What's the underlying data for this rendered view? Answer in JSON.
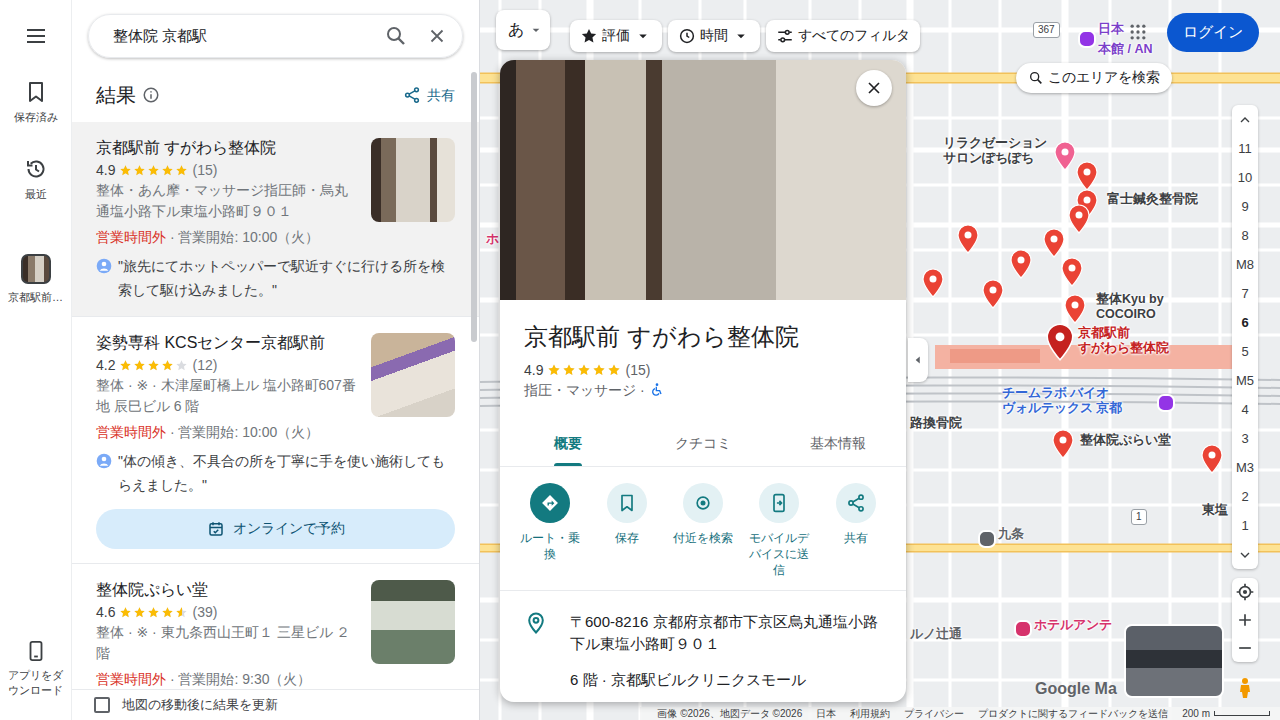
{
  "rail": {
    "items": [
      {
        "label": "保存済み",
        "kind": "saved"
      },
      {
        "label": "最近",
        "kind": "recent"
      },
      {
        "label": "京都駅前…",
        "kind": "place"
      }
    ],
    "download": "アプリをダウンロード"
  },
  "search": {
    "value": "整体院 京都駅"
  },
  "results": {
    "title": "結果",
    "share": "共有",
    "items": [
      {
        "name": "京都駅前 すがわら整体院",
        "rating": "4.9",
        "stars": 5,
        "count": "(15)",
        "details": "整体・あん摩・マッサージ指圧師・烏丸通塩小路下ル東塩小路町９０１",
        "status": "営業時間外",
        "hours": "· 営業開始: 10:00（火）",
        "review": "\"旅先にてホットペッパーで駅近すぐに行ける所を検索して駆け込みました。\"",
        "selected": true
      },
      {
        "name": "姿勢専科 KCSセンター京都駅前",
        "rating": "4.2",
        "stars": 4,
        "count": "(12)",
        "details": "整体 · ※ · 木津屋町橋上ル 塩小路町607番地 辰巳ビル 6 階",
        "status": "営業時間外",
        "hours": "· 営業開始: 10:00（火）",
        "review": "\"体の傾き、不具合の所を丁寧に手を使い施術してもらえました。\"",
        "button": "オンラインで予約",
        "selected": false
      },
      {
        "name": "整体院ぷらい堂",
        "rating": "4.6",
        "stars": 4.5,
        "count": "(39)",
        "details": "整体 · ※ · 東九条西山王町１ 三星ビル ２階",
        "status": "営業時間外",
        "hours": "· 営業開始: 9:30（火）",
        "selected": false
      }
    ],
    "update": {
      "label": "地図の移動後に結果を更新",
      "checked": false
    }
  },
  "map": {
    "language": "あ",
    "chips": [
      {
        "label": "評価",
        "kind": "rating"
      },
      {
        "label": "時間",
        "kind": "hours"
      },
      {
        "label": "すべてのフィルタ",
        "kind": "filters"
      }
    ],
    "login": "ログイン",
    "search_area": "このエリアを検索",
    "floors": [
      {
        "label": "11",
        "selected": false
      },
      {
        "label": "10",
        "selected": false
      },
      {
        "label": "9",
        "selected": false
      },
      {
        "label": "8",
        "selected": false
      },
      {
        "label": "M8",
        "selected": false
      },
      {
        "label": "7",
        "selected": false
      },
      {
        "label": "6",
        "selected": true
      },
      {
        "label": "5",
        "selected": false
      },
      {
        "label": "M5",
        "selected": false
      },
      {
        "label": "4",
        "selected": false
      },
      {
        "label": "3",
        "selected": false
      },
      {
        "label": "M3",
        "selected": false
      },
      {
        "label": "2",
        "selected": false
      },
      {
        "label": "1",
        "selected": false
      }
    ],
    "labels": [
      {
        "text": "日本",
        "color": "#7b3fc9"
      },
      {
        "text": "本館 / AN",
        "color": "#7b3fc9"
      },
      {
        "text": "リラクゼーション\nサロンぽちぽち",
        "color": "#3c4043"
      },
      {
        "text": "富士鍼灸整骨院",
        "color": "#3c4043"
      },
      {
        "text": "整体Kyu by\nCOCOIRO",
        "color": "#3c4043"
      },
      {
        "text": "京都駅前\nすがわら整体院",
        "color": "#c5221f"
      },
      {
        "text": "チームラボ バイオ\nヴォルテックス 京都",
        "color": "#3367d6"
      },
      {
        "text": "路換骨院",
        "color": "#3c4043"
      },
      {
        "text": "整体院ぷらい堂",
        "color": "#3c4043"
      },
      {
        "text": "九条",
        "color": "#5f6368"
      },
      {
        "text": "ホテルアンテ",
        "color": "#d6336c"
      },
      {
        "text": "ルノ辻通",
        "color": "#5f6368"
      },
      {
        "text": "東塩",
        "color": "#3c4043"
      },
      {
        "text": "ホ",
        "color": "#d6336c"
      }
    ],
    "shields": [
      "367",
      "1"
    ],
    "logo": "Google Ma",
    "footer": [
      "画像 ©2026、地図データ ©2026",
      "日本",
      "利用規約",
      "プライバシー",
      "プロダクトに関するフィードバックを送信"
    ],
    "scale": "200 m"
  },
  "place": {
    "title": "京都駅前 すがわら整体院",
    "rating": "4.9",
    "stars": 5,
    "count": "(15)",
    "category": "指圧・マッサージ",
    "separator": "·",
    "tabs": [
      {
        "label": "概要",
        "selected": true
      },
      {
        "label": "クチコミ",
        "selected": false
      },
      {
        "label": "基本情報",
        "selected": false
      }
    ],
    "actions": [
      {
        "label": "ルート・乗換",
        "kind": "directions"
      },
      {
        "label": "保存",
        "kind": "save"
      },
      {
        "label": "付近を検索",
        "kind": "nearby"
      },
      {
        "label": "モバイルデバイスに送信",
        "kind": "send"
      },
      {
        "label": "共有",
        "kind": "share"
      }
    ],
    "address": [
      "〒600-8216 京都府京都市下京区烏丸通塩小路下ル東塩小路町９０１",
      "6 階 · 京都駅ビルクリニクスモール"
    ]
  }
}
